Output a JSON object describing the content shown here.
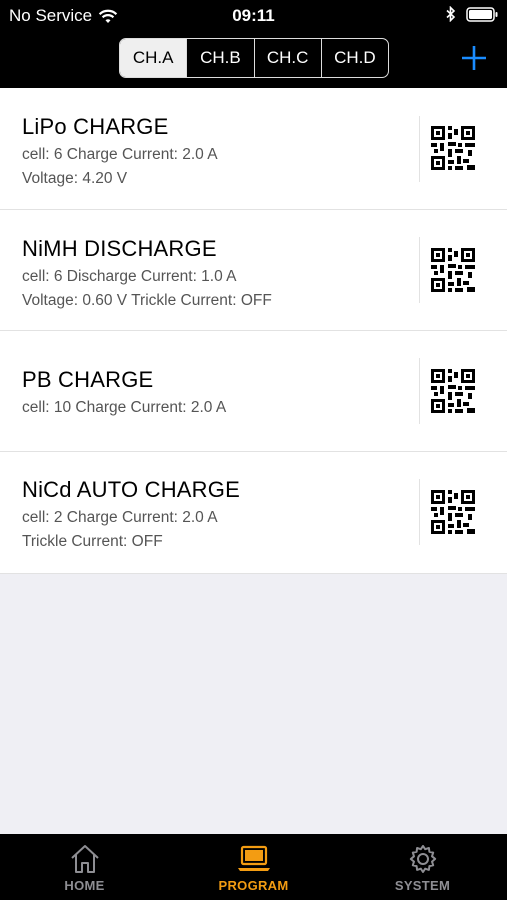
{
  "status_bar": {
    "carrier": "No Service",
    "time": "09:11"
  },
  "channels": {
    "tabs": [
      "CH.A",
      "CH.B",
      "CH.C",
      "CH.D"
    ],
    "selected": "CH.A"
  },
  "add_icon": "plus-icon",
  "programs": [
    {
      "title": "LiPo  CHARGE",
      "lines": [
        "cell: 6  Charge Current: 2.0 A",
        "Voltage: 4.20 V"
      ]
    },
    {
      "title": "NiMH  DISCHARGE",
      "lines": [
        "cell: 6  Discharge Current: 1.0 A",
        "Voltage: 0.60 V  Trickle Current: OFF"
      ]
    },
    {
      "title": "PB  CHARGE",
      "lines": [
        "cell: 10  Charge Current: 2.0 A"
      ]
    },
    {
      "title": "NiCd  AUTO CHARGE",
      "lines": [
        "cell: 2  Charge Current: 2.0 A",
        "Trickle Current: OFF"
      ]
    }
  ],
  "tab_bar": {
    "items": [
      {
        "label": "HOME",
        "icon": "home-icon"
      },
      {
        "label": "PROGRAM",
        "icon": "laptop-icon"
      },
      {
        "label": "SYSTEM",
        "icon": "gear-icon"
      }
    ],
    "active": "PROGRAM"
  },
  "colors": {
    "accent_blue": "#1a8cff",
    "active_orange": "#f39c12"
  }
}
